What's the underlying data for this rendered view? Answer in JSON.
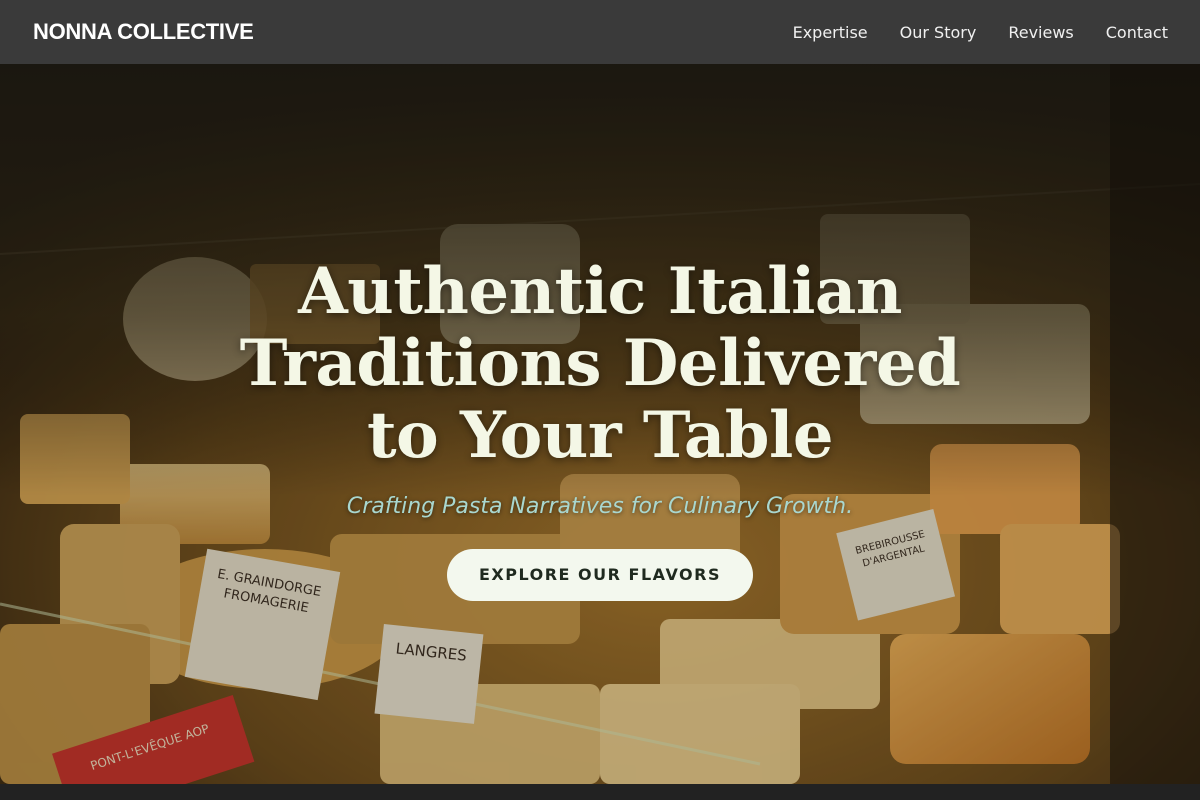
{
  "header": {
    "brand": "NONNA COLLECTIVE",
    "nav": [
      {
        "label": "Expertise"
      },
      {
        "label": "Our Story"
      },
      {
        "label": "Reviews"
      },
      {
        "label": "Contact"
      }
    ]
  },
  "hero": {
    "title": "Authentic Italian Traditions Delivered to Your Table",
    "subtitle": "Crafting Pasta Narratives for Culinary Growth.",
    "cta_label": "EXPLORE OUR FLAVORS",
    "labels": {
      "label_1": "E. GRAINDORGE FROMAGERIE",
      "label_2": "LANGRES",
      "label_3": "BREBIROUSSE D'ARGENTAL",
      "label_4": "PONT-L'EVÊQUE AOP"
    }
  },
  "colors": {
    "header_bg": "#3a3a3a",
    "title": "#f4f7e6",
    "subtitle": "#a9d7cf",
    "cta_bg": "#f3f8ee",
    "cta_text": "#1f2a1f"
  }
}
